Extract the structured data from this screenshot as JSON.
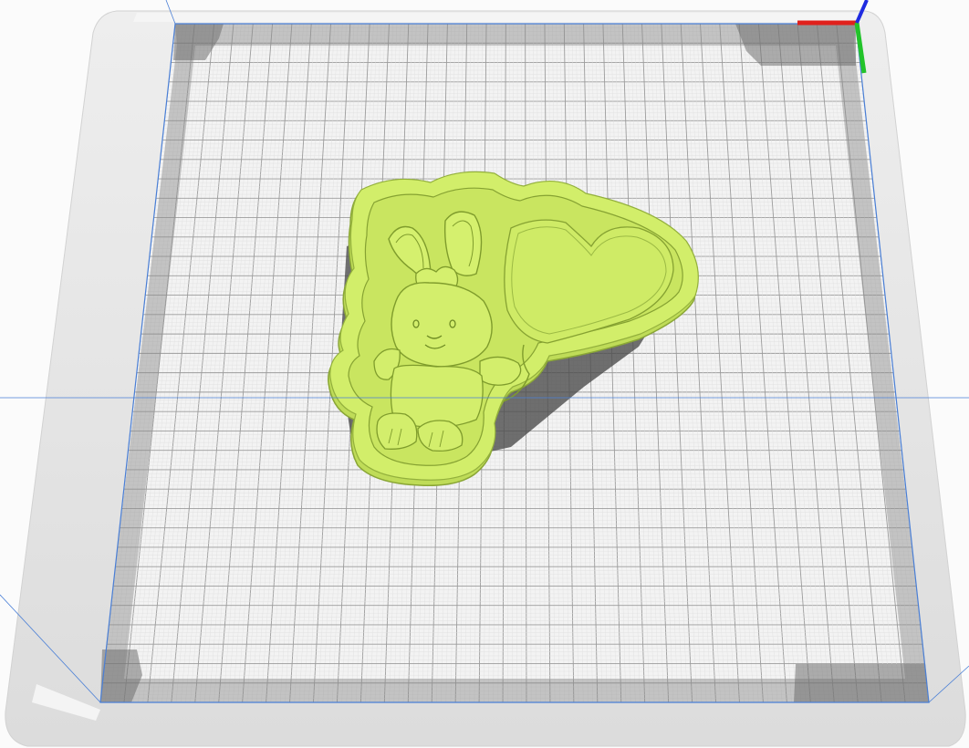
{
  "scene": {
    "type": "3d-slicer-build-plate-view",
    "object": "bunny-with-heart-balloon-cutter",
    "colors": {
      "background": "#fbfbfb",
      "plate_frame": "#e4e4e4",
      "plate_frame_edge": "#d0d0d0",
      "disallowed_border": "#9a9a9a",
      "bed_surface": "#f2f2f2",
      "grid_major": "#9c9c9c",
      "grid_minor": "#dedede",
      "bounding_line": "#4a7fd6",
      "model_fill": "#cdeb68",
      "model_shade": "#a9c84a",
      "model_line": "#7f9c2c",
      "shadow": "#5c5c5c",
      "axis_x": "#e0201c",
      "axis_y": "#22c32a",
      "axis_z": "#1f2be0"
    }
  }
}
